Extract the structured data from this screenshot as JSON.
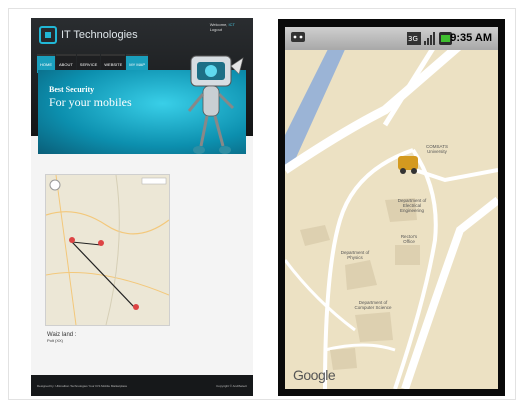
{
  "website": {
    "logo_text": "IT Technologies",
    "welcome_line": "Welcome,",
    "welcome_user": "ICT",
    "logout": "Logout",
    "nav": [
      "HOME",
      "ABOUT",
      "SERVICE",
      "WEBSITE",
      "MY MAP"
    ],
    "banner_subtitle": "Best Security",
    "banner_title": "For your mobiles",
    "map_caption": "Waiz land :",
    "map_caption_sub": "Polt (XX)",
    "footer_left": "Designed by: Ultimaltion Technologies  Your ICS Mobile Marketplace",
    "footer_right": "Copyright © AndiSelect"
  },
  "phone": {
    "time": "9:35 AM",
    "map_labels": [
      "COMSATS University",
      "Department of Electrical Engineering",
      "Rector's Office",
      "Department of Physics",
      "Department of Computer Science"
    ],
    "brand": "Google"
  }
}
